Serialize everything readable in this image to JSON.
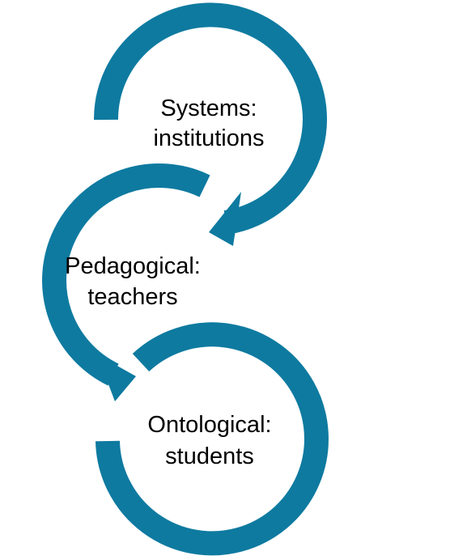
{
  "colors": {
    "arrow": "#0e7aa0",
    "text": "#000000",
    "background": "#ffffff"
  },
  "cycles": [
    {
      "line1": "Systems:",
      "line2": "institutions"
    },
    {
      "line1": "Pedagogical:",
      "line2": "teachers"
    },
    {
      "line1": "Ontological:",
      "line2": "students"
    }
  ]
}
